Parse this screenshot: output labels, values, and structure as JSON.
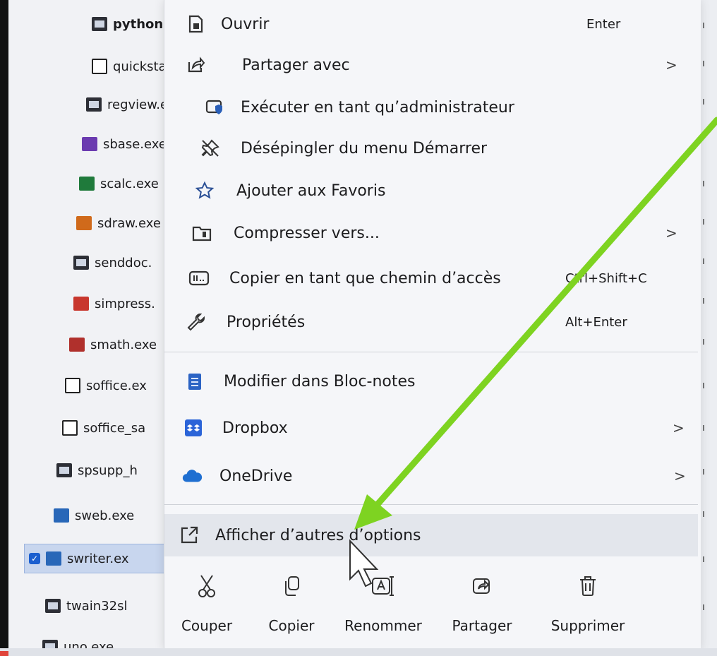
{
  "file_list": [
    {
      "name": "python.ex",
      "icon": "exe-icon"
    },
    {
      "name": "quickstart",
      "icon": "document-icon"
    },
    {
      "name": "regview.e",
      "icon": "exe-icon"
    },
    {
      "name": "sbase.exe",
      "icon": "base-icon"
    },
    {
      "name": "scalc.exe",
      "icon": "calc-icon"
    },
    {
      "name": "sdraw.exe",
      "icon": "draw-icon"
    },
    {
      "name": "senddoc.",
      "icon": "exe-icon"
    },
    {
      "name": "simpress.",
      "icon": "impress-icon"
    },
    {
      "name": "smath.exe",
      "icon": "math-icon"
    },
    {
      "name": "soffice.ex",
      "icon": "document-icon"
    },
    {
      "name": "soffice_sa",
      "icon": "document-icon"
    },
    {
      "name": "spsupp_h",
      "icon": "exe-icon"
    },
    {
      "name": "sweb.exe",
      "icon": "writer-icon"
    },
    {
      "name": "swriter.ex",
      "icon": "writer-icon",
      "selected": true
    },
    {
      "name": "twain32sl",
      "icon": "exe-icon"
    },
    {
      "name": "uno.exe",
      "icon": "exe-icon"
    }
  ],
  "context_menu": {
    "items": [
      {
        "label": "Ouvrir",
        "shortcut": "Enter",
        "icon": "open-icon"
      },
      {
        "label": "Partager avec",
        "submenu": ">",
        "icon": "share-icon"
      },
      {
        "label": "Exécuter en tant qu’administrateur",
        "icon": "admin-shield-icon"
      },
      {
        "label": "Désépingler du menu Démarrer",
        "icon": "unpin-icon"
      },
      {
        "label": "Ajouter aux Favoris",
        "icon": "star-icon"
      },
      {
        "label": "Compresser vers...",
        "submenu": ">",
        "icon": "zip-folder-icon"
      },
      {
        "label": "Copier en tant que chemin d’accès",
        "shortcut": "Ctrl+Shift+C",
        "icon": "copy-path-icon"
      },
      {
        "label": "Propriétés",
        "shortcut": "Alt+Enter",
        "icon": "wrench-icon"
      },
      {
        "label": "Modifier dans Bloc-notes",
        "icon": "notepad-icon"
      },
      {
        "label": "Dropbox",
        "submenu": ">",
        "icon": "dropbox-icon"
      },
      {
        "label": "OneDrive",
        "submenu": ">",
        "icon": "onedrive-icon"
      },
      {
        "label": "Afficher d’autres d’options",
        "icon": "expand-icon"
      }
    ],
    "actions": [
      {
        "label": "Couper",
        "icon": "scissors-icon"
      },
      {
        "label": "Copier",
        "icon": "copy-icon"
      },
      {
        "label": "Renommer",
        "icon": "rename-icon"
      },
      {
        "label": "Partager",
        "icon": "share-icon"
      },
      {
        "label": "Supprimer",
        "icon": "trash-icon"
      }
    ]
  },
  "colors": {
    "annotation_arrow": "#7ed321",
    "selection": "#c8d6ee",
    "menu_background": "#f5f6f9"
  }
}
